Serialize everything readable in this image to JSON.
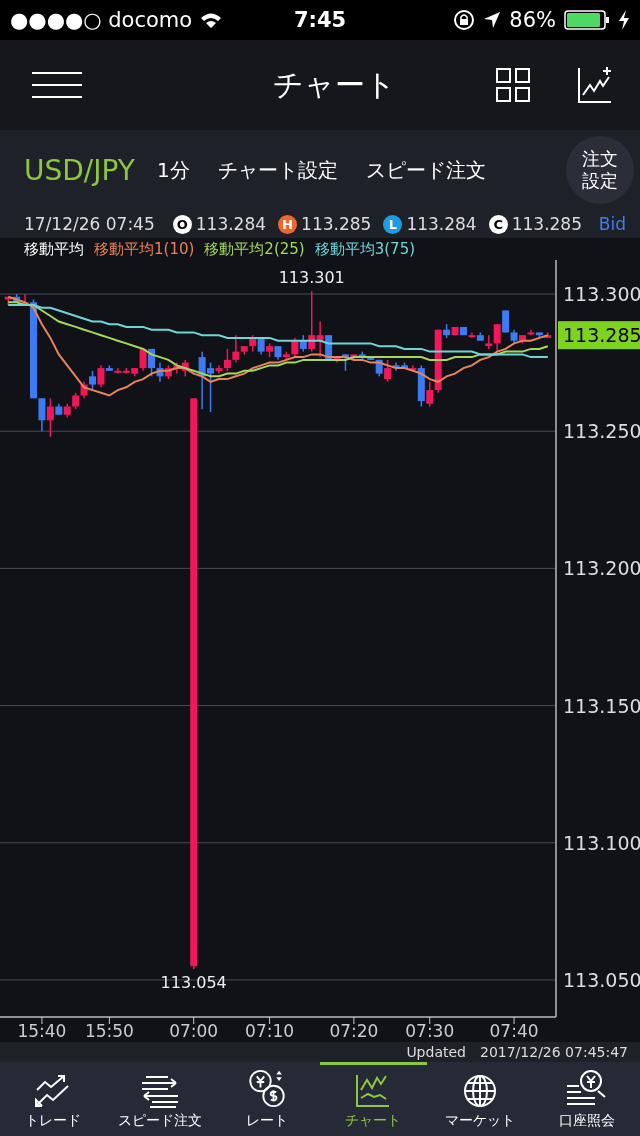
{
  "status_bar": {
    "carrier": "●●●●○ docomo",
    "time": "7:45",
    "battery": "86%"
  },
  "header": {
    "title": "チャート"
  },
  "toolbar": {
    "pair": "USD/JPY",
    "interval": "1分",
    "chart_settings": "チャート設定",
    "speed_order": "スピード注文",
    "order_settings": "注文設定"
  },
  "ohlc": {
    "datetime": "17/12/26 07:45",
    "items": [
      {
        "letter": "O",
        "value": "113.284",
        "color": "#ffffff"
      },
      {
        "letter": "H",
        "value": "113.285",
        "color": "#f0642d"
      },
      {
        "letter": "L",
        "value": "113.284",
        "color": "#1e9be6"
      },
      {
        "letter": "C",
        "value": "113.285",
        "color": "#ffffff"
      }
    ],
    "side": "Bid"
  },
  "legend": {
    "title": "移動平均"
  },
  "chart_data": {
    "type": "candlestick",
    "grid": true,
    "ylim": [
      113.0365,
      113.3124
    ],
    "categories": [
      null,
      null,
      null,
      null,
      "15:40",
      null,
      null,
      null,
      null,
      null,
      null,
      null,
      "15:50",
      null,
      null,
      null,
      null,
      null,
      null,
      null,
      null,
      null,
      "07:00",
      null,
      null,
      null,
      null,
      null,
      null,
      null,
      null,
      "07:10",
      null,
      null,
      null,
      null,
      null,
      null,
      null,
      null,
      null,
      "07:20",
      null,
      null,
      null,
      null,
      null,
      null,
      null,
      null,
      "07:30",
      null,
      null,
      null,
      null,
      null,
      null,
      null,
      null,
      null,
      "07:40",
      null,
      null,
      null,
      null
    ],
    "yticks": [
      {
        "value": 113.3,
        "label": "113.300"
      },
      {
        "value": 113.25,
        "label": "113.250"
      },
      {
        "value": 113.2,
        "label": "113.200"
      },
      {
        "value": 113.15,
        "label": "113.150"
      },
      {
        "value": 113.1,
        "label": "113.100"
      },
      {
        "value": 113.05,
        "label": "113.050"
      }
    ],
    "ohlc": [
      [
        113.298,
        113.299,
        113.296,
        113.299
      ],
      [
        113.299,
        113.3,
        113.297,
        113.297
      ],
      [
        113.297,
        113.3,
        113.296,
        113.297
      ],
      [
        113.297,
        113.298,
        113.262,
        113.262
      ],
      [
        113.262,
        113.262,
        113.25,
        113.254
      ],
      [
        113.254,
        113.262,
        113.248,
        113.259
      ],
      [
        113.259,
        113.26,
        113.256,
        113.256
      ],
      [
        113.256,
        113.26,
        113.255,
        113.259
      ],
      [
        113.259,
        113.264,
        113.258,
        113.263
      ],
      [
        113.263,
        113.268,
        113.262,
        113.267
      ],
      [
        113.27,
        113.272,
        113.265,
        113.267
      ],
      [
        113.267,
        113.274,
        113.266,
        113.273
      ],
      [
        113.273,
        113.274,
        113.272,
        113.272
      ],
      [
        113.272,
        113.273,
        113.271,
        113.272
      ],
      [
        113.272,
        113.273,
        113.271,
        113.272
      ],
      [
        113.271,
        113.273,
        113.27,
        113.273
      ],
      [
        113.273,
        113.28,
        113.272,
        113.28
      ],
      [
        113.28,
        113.28,
        113.27,
        113.273
      ],
      [
        113.273,
        113.275,
        113.268,
        113.27
      ],
      [
        113.27,
        113.274,
        113.269,
        113.273
      ],
      [
        113.273,
        113.275,
        113.271,
        113.274
      ],
      [
        113.272,
        113.276,
        113.27,
        113.275
      ],
      [
        113.055,
        113.262,
        113.054,
        113.262
      ],
      [
        113.277,
        113.279,
        113.258,
        113.27
      ],
      [
        113.273,
        113.275,
        113.257,
        113.271
      ],
      [
        113.272,
        113.274,
        113.271,
        113.273
      ],
      [
        113.273,
        113.28,
        113.272,
        113.276
      ],
      [
        113.276,
        113.285,
        113.275,
        113.279
      ],
      [
        113.279,
        113.281,
        113.278,
        113.281
      ],
      [
        113.281,
        113.285,
        113.279,
        113.284
      ],
      [
        113.284,
        113.284,
        113.278,
        113.279
      ],
      [
        113.279,
        113.282,
        113.277,
        113.281
      ],
      [
        113.281,
        113.281,
        113.276,
        113.277
      ],
      [
        113.277,
        113.279,
        113.276,
        113.278
      ],
      [
        113.278,
        113.284,
        113.277,
        113.283
      ],
      [
        113.283,
        113.285,
        113.279,
        113.28
      ],
      [
        113.28,
        113.301,
        113.279,
        113.285
      ],
      [
        113.283,
        113.29,
        113.277,
        113.285
      ],
      [
        113.285,
        113.285,
        113.276,
        113.276
      ],
      [
        113.276,
        113.277,
        113.275,
        113.277
      ],
      [
        113.278,
        113.278,
        113.272,
        113.277
      ],
      [
        113.277,
        113.278,
        113.276,
        113.278
      ],
      [
        113.278,
        113.279,
        113.276,
        113.277
      ],
      [
        113.277,
        113.277,
        113.276,
        113.276
      ],
      [
        113.276,
        113.276,
        113.27,
        113.271
      ],
      [
        113.269,
        113.276,
        113.268,
        113.273
      ],
      [
        113.274,
        113.275,
        113.272,
        113.273
      ],
      [
        113.274,
        113.275,
        113.273,
        113.273
      ],
      [
        113.273,
        113.274,
        113.272,
        113.273
      ],
      [
        113.273,
        113.274,
        113.259,
        113.261
      ],
      [
        113.26,
        113.268,
        113.259,
        113.265
      ],
      [
        113.265,
        113.287,
        113.264,
        113.287
      ],
      [
        113.287,
        113.289,
        113.284,
        113.285
      ],
      [
        113.285,
        113.288,
        113.285,
        113.288
      ],
      [
        113.288,
        113.288,
        113.285,
        113.285
      ],
      [
        113.285,
        113.286,
        113.284,
        113.285
      ],
      [
        113.285,
        113.286,
        113.283,
        113.283
      ],
      [
        113.281,
        113.285,
        113.28,
        113.282
      ],
      [
        113.282,
        113.289,
        113.278,
        113.289
      ],
      [
        113.294,
        113.294,
        113.286,
        113.286
      ],
      [
        113.286,
        113.287,
        113.282,
        113.283
      ],
      [
        113.283,
        113.285,
        113.282,
        113.285
      ],
      [
        113.286,
        113.287,
        113.285,
        113.286
      ],
      [
        113.286,
        113.286,
        113.284,
        113.285
      ],
      [
        113.284,
        113.286,
        113.284,
        113.285
      ]
    ],
    "series": [
      {
        "name": "移動平均1(10)",
        "type": "line",
        "color": "#e8845a",
        "values": [
          113.299,
          113.298,
          113.297,
          113.295,
          113.289,
          113.284,
          113.278,
          113.274,
          113.27,
          113.266,
          113.265,
          113.264,
          113.263,
          113.265,
          113.266,
          113.268,
          113.269,
          113.271,
          113.272,
          113.272,
          113.273,
          113.273,
          113.271,
          113.27,
          113.268,
          113.269,
          113.269,
          113.27,
          113.271,
          113.273,
          113.274,
          113.275,
          113.275,
          113.276,
          113.277,
          113.277,
          113.278,
          113.278,
          113.277,
          113.277,
          113.277,
          113.276,
          113.276,
          113.275,
          113.275,
          113.274,
          113.273,
          113.273,
          113.272,
          113.271,
          113.269,
          113.268,
          113.27,
          113.271,
          113.273,
          113.274,
          113.276,
          113.277,
          113.279,
          113.28,
          113.282,
          113.283,
          113.283,
          113.284,
          113.285
        ]
      },
      {
        "name": "移動平均2(25)",
        "type": "line",
        "color": "#a6d85a",
        "values": [
          113.297,
          113.297,
          113.296,
          113.296,
          113.294,
          113.292,
          113.29,
          113.289,
          113.288,
          113.287,
          113.286,
          113.285,
          113.284,
          113.283,
          113.282,
          113.281,
          113.28,
          113.278,
          113.277,
          113.276,
          113.274,
          113.273,
          113.272,
          113.271,
          113.27,
          113.27,
          113.271,
          113.271,
          113.272,
          113.272,
          113.273,
          113.274,
          113.274,
          113.275,
          113.275,
          113.276,
          113.276,
          113.276,
          113.276,
          113.276,
          113.276,
          113.277,
          113.277,
          113.277,
          113.277,
          113.277,
          113.277,
          113.277,
          113.277,
          113.277,
          113.276,
          113.276,
          113.276,
          113.277,
          113.277,
          113.277,
          113.278,
          113.278,
          113.278,
          113.279,
          113.279,
          113.279,
          113.28,
          113.28,
          113.281
        ]
      },
      {
        "name": "移動平均3(75)",
        "type": "line",
        "color": "#6fd6d6",
        "values": [
          113.296,
          113.296,
          113.296,
          113.296,
          113.295,
          113.295,
          113.294,
          113.293,
          113.292,
          113.291,
          113.29,
          113.29,
          113.289,
          113.289,
          113.288,
          113.288,
          113.288,
          113.287,
          113.287,
          113.287,
          113.286,
          113.286,
          113.286,
          113.285,
          113.285,
          113.285,
          113.284,
          113.284,
          113.284,
          113.284,
          113.284,
          113.284,
          113.283,
          113.283,
          113.283,
          113.283,
          113.283,
          113.283,
          113.282,
          113.282,
          113.282,
          113.282,
          113.282,
          113.282,
          113.281,
          113.281,
          113.281,
          113.28,
          113.28,
          113.28,
          113.279,
          113.279,
          113.279,
          113.279,
          113.279,
          113.279,
          113.278,
          113.278,
          113.278,
          113.278,
          113.278,
          113.278,
          113.277,
          113.277,
          113.277
        ]
      }
    ],
    "annotations": [
      "113.301",
      "113.054",
      "113.285"
    ]
  },
  "updated": {
    "label": "Updated",
    "time": "2017/12/26 07:45:47"
  },
  "tabs": [
    {
      "label": "トレード",
      "selected": false
    },
    {
      "label": "スピード注文",
      "selected": false
    },
    {
      "label": "レート",
      "selected": false
    },
    {
      "label": "チャート",
      "selected": true
    },
    {
      "label": "マーケット",
      "selected": false
    },
    {
      "label": "口座照会",
      "selected": false
    }
  ]
}
